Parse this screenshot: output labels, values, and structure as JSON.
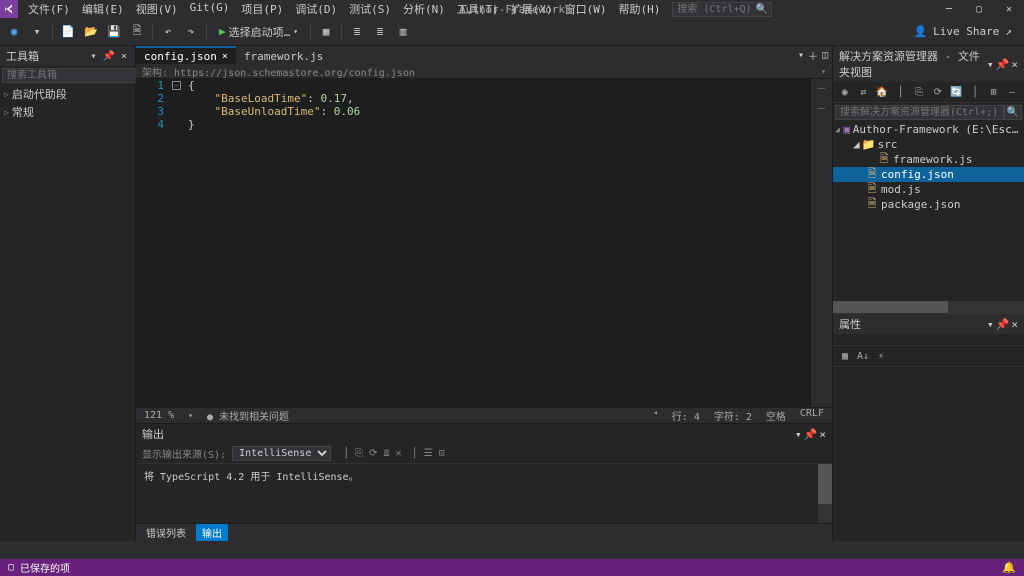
{
  "window": {
    "title": "Author-Framework"
  },
  "menu": {
    "file": "文件(F)",
    "edit": "编辑(E)",
    "view": "视图(V)",
    "git": "Git(G)",
    "project": "项目(P)",
    "debug": "调试(D)",
    "test": "测试(S)",
    "analyze": "分析(N)",
    "tools": "工具(T)",
    "ext": "扩展(X)",
    "window": "窗口(W)",
    "help": "帮助(H)"
  },
  "search": {
    "placeholder": "搜索 (Ctrl+Q)"
  },
  "toolbar": {
    "config_label": "选择启动项…"
  },
  "liveshare": "Live Share",
  "toolbox": {
    "title": "工具箱",
    "search_placeholder": "搜索工具箱",
    "items": [
      "启动代助段",
      "常规"
    ]
  },
  "tabs": [
    {
      "label": "config.json",
      "active": true
    },
    {
      "label": "framework.js",
      "active": false
    }
  ],
  "schema": {
    "text": "架构: https://json.schemastore.org/config.json"
  },
  "code_lines": [
    {
      "n": "1",
      "html": "{"
    },
    {
      "n": "2",
      "html": "    <span class='str-key'>\"BaseLoadTime\"</span>: <span class='num'>0.17</span>,"
    },
    {
      "n": "3",
      "html": "    <span class='str-key'>\"BaseUnloadTime\"</span>: <span class='num'>0.06</span>"
    },
    {
      "n": "4",
      "html": "}"
    }
  ],
  "editor_status": {
    "zoom": "121 %",
    "issues": "● 未找到相关问题",
    "line": "行: 4",
    "char": "字符: 2",
    "spaces": "空格",
    "crlf": "CRLF"
  },
  "output": {
    "title": "输出",
    "filter_label": "显示输出来源(S):",
    "filter_value": "IntelliSense",
    "text": "将 TypeScript 4.2 用于 IntelliSense。"
  },
  "bottom_tabs": {
    "err": "错误列表",
    "out": "输出"
  },
  "sol": {
    "title": "解决方案资源管理器 - 文件夹视图",
    "search_placeholder": "搜索解决方案资源管理器(Ctrl+;)",
    "root": "Author-Framework (E:\\EscapeFromTarkov\\user\\mo",
    "nodes": [
      {
        "depth": 1,
        "label": "src",
        "type": "folder",
        "open": true
      },
      {
        "depth": 2,
        "label": "framework.js",
        "type": "js"
      },
      {
        "depth": 1,
        "label": "config.json",
        "type": "json",
        "selected": true
      },
      {
        "depth": 1,
        "label": "mod.js",
        "type": "js"
      },
      {
        "depth": 1,
        "label": "package.json",
        "type": "json"
      }
    ]
  },
  "props": {
    "title": "属性"
  },
  "status": {
    "saved": "已保存的项"
  }
}
